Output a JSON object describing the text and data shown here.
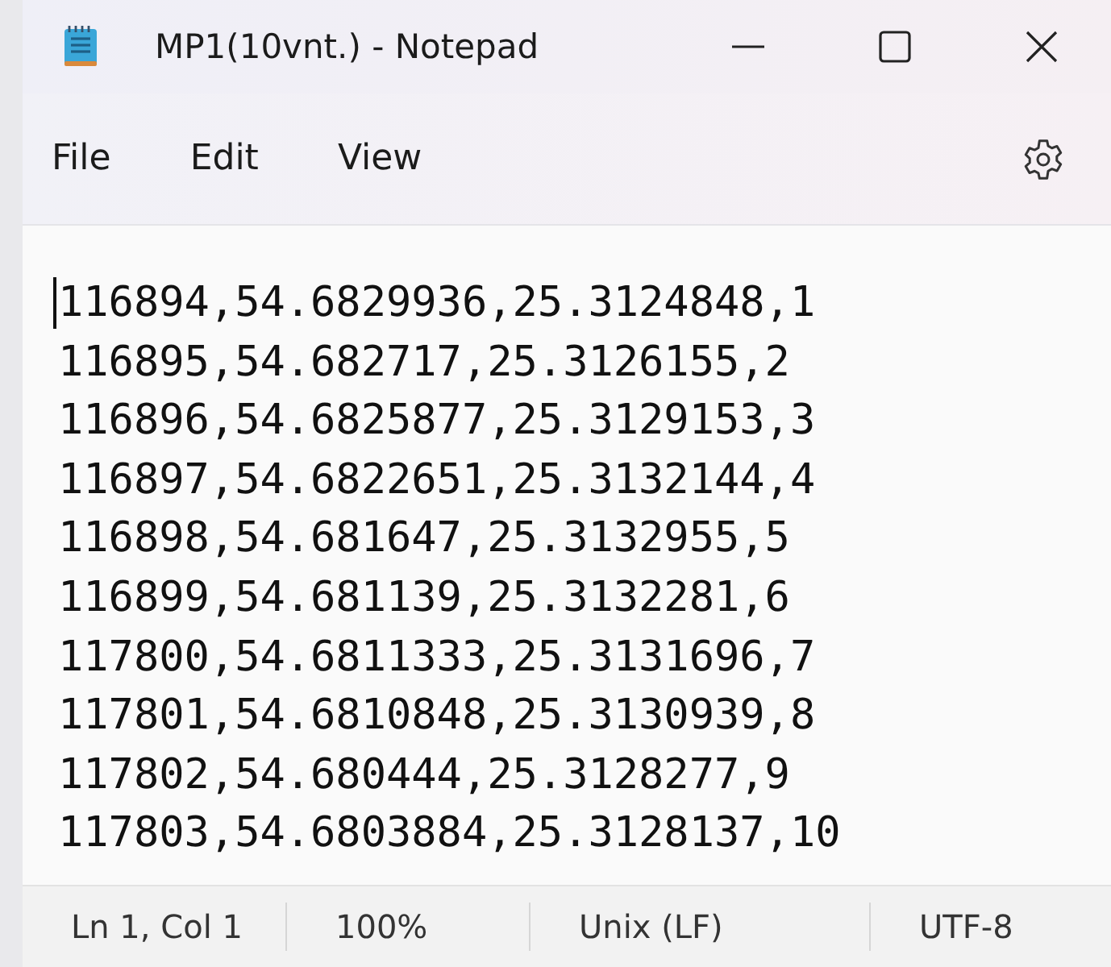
{
  "window": {
    "title": "MP1(10vnt.) - Notepad"
  },
  "menu": [
    "File",
    "Edit",
    "View"
  ],
  "lines": [
    "116894,54.6829936,25.3124848,1",
    "116895,54.682717,25.3126155,2",
    "116896,54.6825877,25.3129153,3",
    "116897,54.6822651,25.3132144,4",
    "116898,54.681647,25.3132955,5",
    "116899,54.681139,25.3132281,6",
    "117800,54.6811333,25.3131696,7",
    "117801,54.6810848,25.3130939,8",
    "117802,54.680444,25.3128277,9",
    "117803,54.6803884,25.3128137,10"
  ],
  "status_bar": [
    "Ln 1, Col 1",
    "100%",
    "Unix (LF)",
    "UTF-8"
  ]
}
